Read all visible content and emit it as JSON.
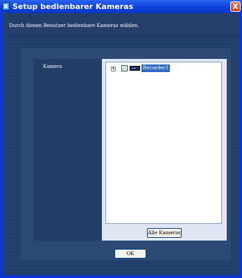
{
  "window": {
    "title": "Setup bedienbarer Kameras",
    "close_symbol": "X"
  },
  "instruction_text": "Durch diesen Benutzer bedienbare Kameras wählen.",
  "camera_section": {
    "label": "Kamera",
    "tree": {
      "expand_symbol": "+",
      "items": [
        {
          "label": "Recorder1",
          "checked": true,
          "icon": "recorder-icon"
        }
      ]
    },
    "all_cameras_button": "Alle Kameras"
  },
  "ok_button": "OK",
  "colors": {
    "titlebar": "#0b3fd6",
    "background": "#233f6a",
    "selection": "#316ac5",
    "check": "#21a121"
  }
}
